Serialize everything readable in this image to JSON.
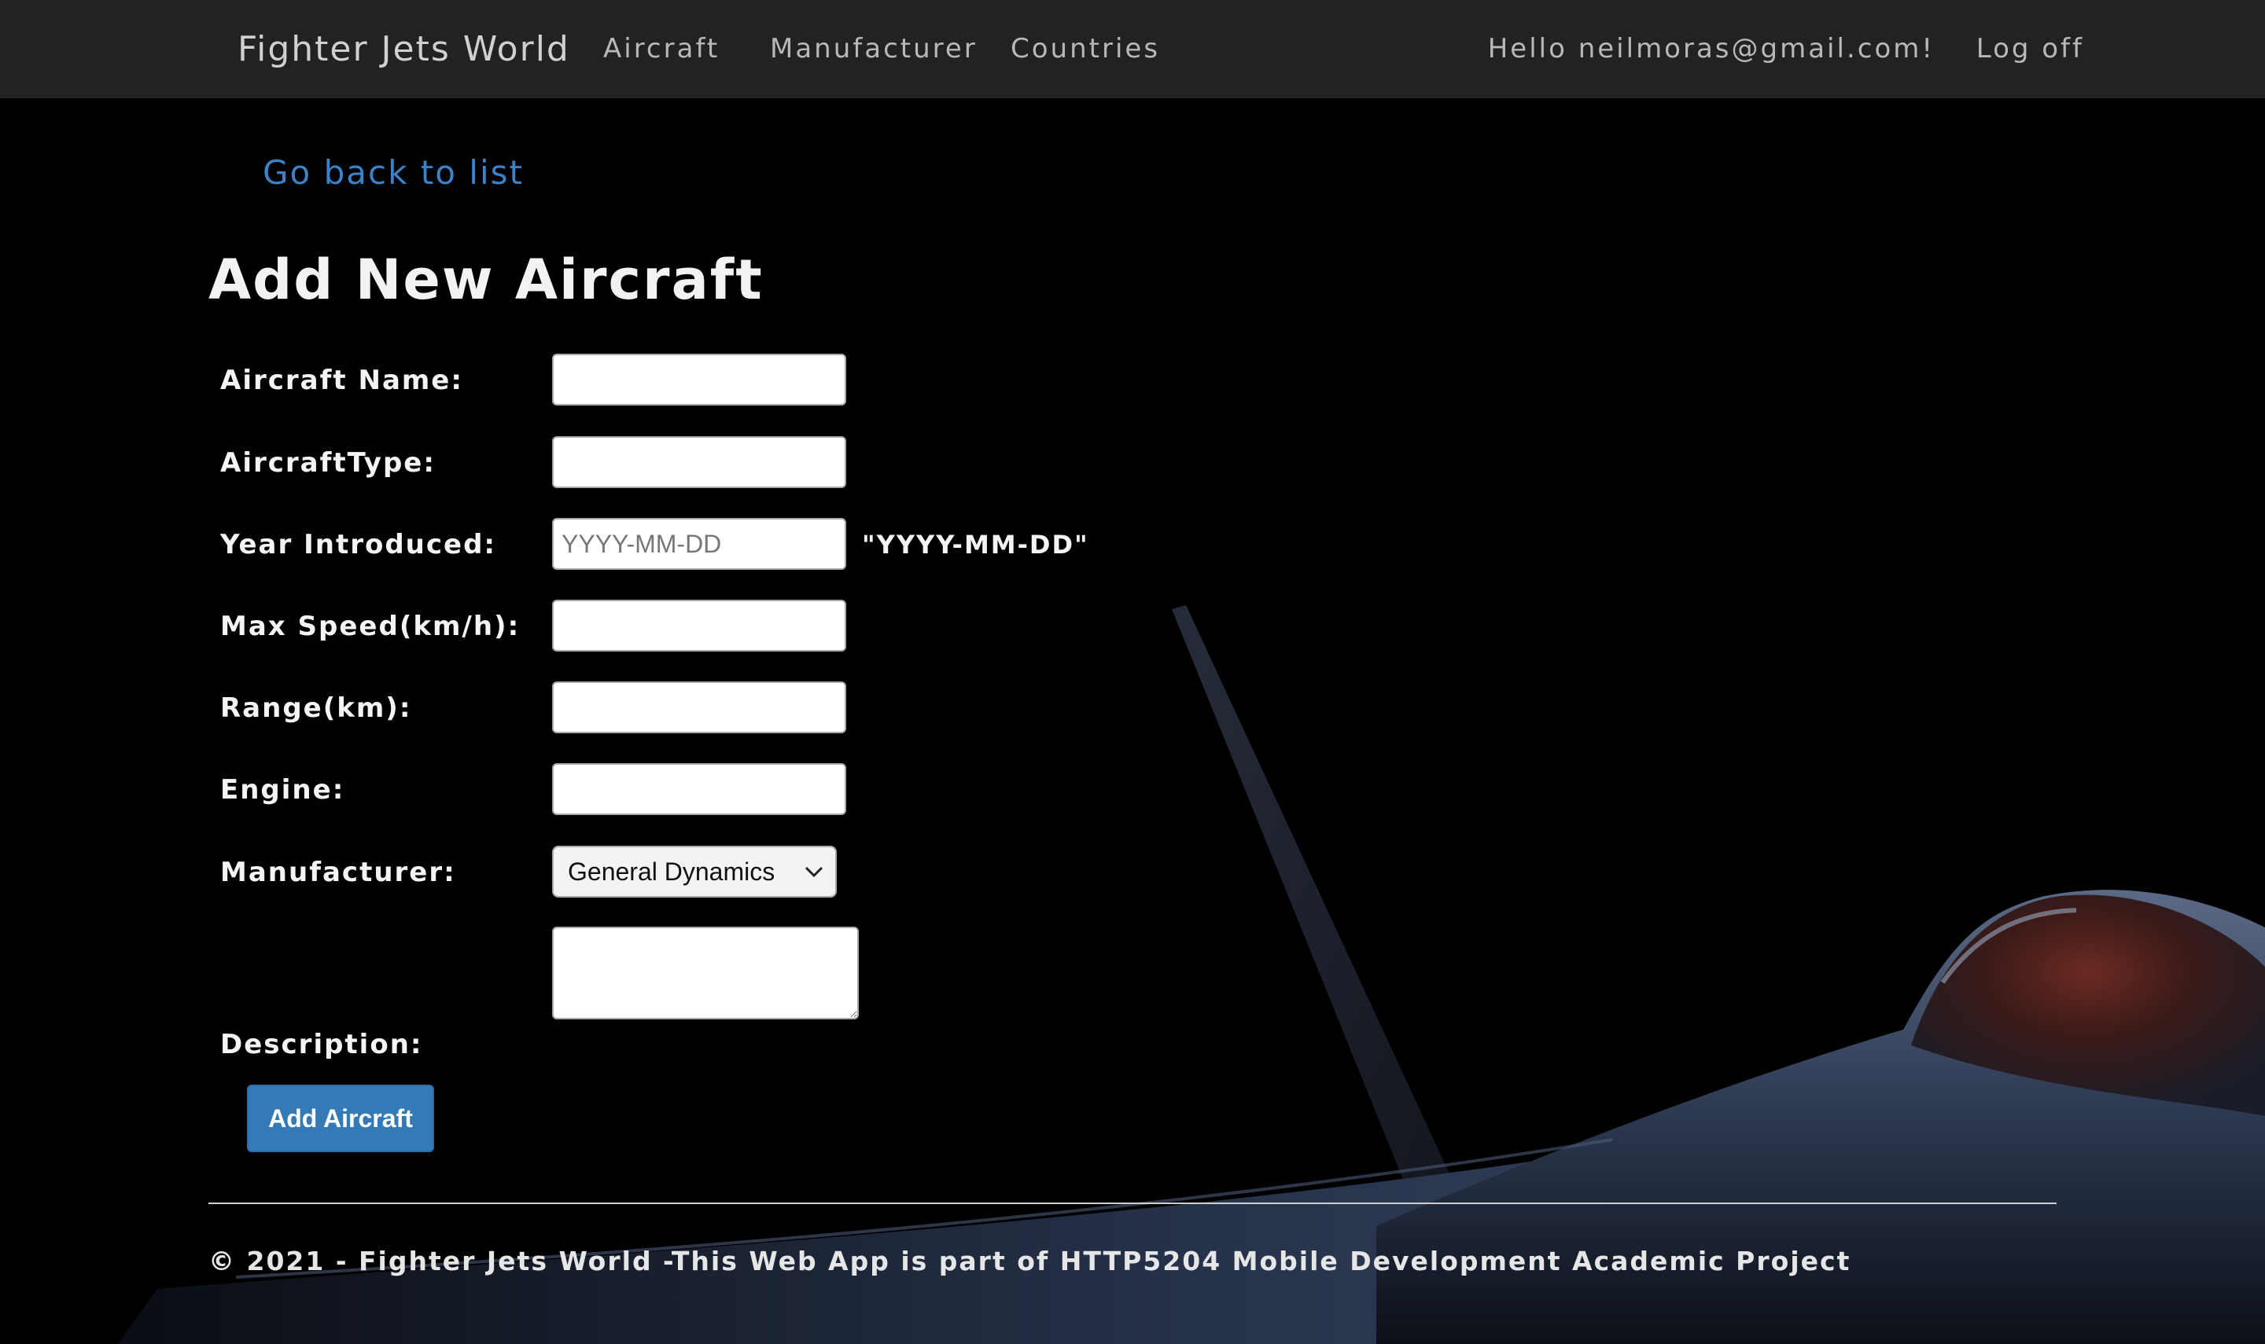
{
  "navbar": {
    "brand": "Fighter Jets World",
    "links": [
      "Aircraft",
      "Manufacturer",
      "Countries"
    ],
    "greeting": "Hello neilmoras@gmail.com!",
    "logoff": "Log off"
  },
  "back_link": "Go back to list",
  "page_title": "Add New Aircraft",
  "form": {
    "aircraft_name": {
      "label": "Aircraft Name:",
      "value": ""
    },
    "aircraft_type": {
      "label": "AircraftType:",
      "value": ""
    },
    "year_introduced": {
      "label": "Year Introduced:",
      "placeholder": "YYYY-MM-DD",
      "hint": "\"YYYY-MM-DD\"",
      "value": ""
    },
    "max_speed": {
      "label": "Max Speed(km/h):",
      "value": ""
    },
    "range": {
      "label": "Range(km):",
      "value": ""
    },
    "engine": {
      "label": "Engine:",
      "value": ""
    },
    "manufacturer": {
      "label": "Manufacturer:",
      "selected": "General Dynamics"
    },
    "description": {
      "label": "Description:",
      "value": ""
    },
    "submit_label": "Add Aircraft"
  },
  "footer": {
    "text": "© 2021 - Fighter Jets World -This Web App is part of HTTP5204 Mobile Development Academic Project"
  },
  "colors": {
    "navbar_bg": "#222222",
    "page_bg": "#000000",
    "link_blue": "#3c82c8",
    "button_blue": "#337ab7"
  },
  "icons": {
    "select_arrow": "chevron-down-icon",
    "background": "fighter-jet-image"
  }
}
